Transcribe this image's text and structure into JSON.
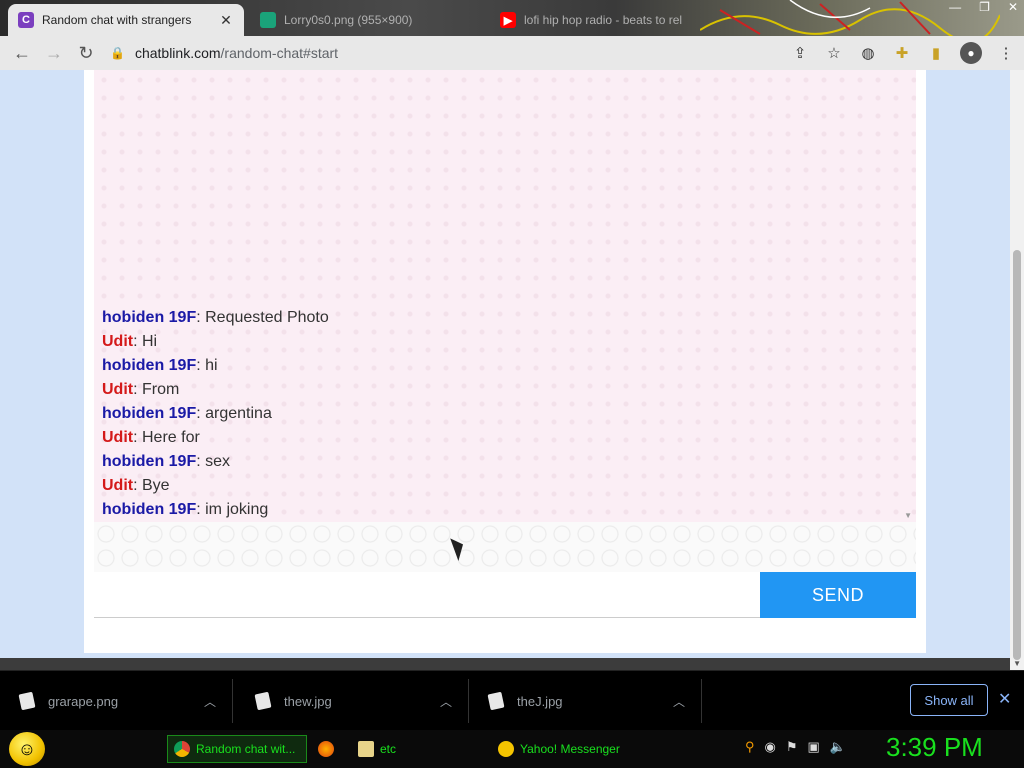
{
  "browser": {
    "tabs": [
      {
        "title": "Random chat with strangers",
        "favicon_letter": "C",
        "favicon_color": "#7b3fbf",
        "active": true
      },
      {
        "title": "Lorry0s0.png (955×900)",
        "favicon_color": "#1aa37a",
        "active": false
      },
      {
        "title": "lofi hip hop radio - beats to rel",
        "favicon_color": "#ff0000",
        "active": false
      }
    ],
    "url_domain": "chatblink.com",
    "url_path": "/random-chat#start"
  },
  "chat": {
    "messages": [
      {
        "sender": "hobiden 19F",
        "role": "stranger",
        "text": ": Requested Photo"
      },
      {
        "sender": "Udit",
        "role": "me",
        "text": ": Hi"
      },
      {
        "sender": "hobiden 19F",
        "role": "stranger",
        "text": ": hi"
      },
      {
        "sender": "Udit",
        "role": "me",
        "text": ": From"
      },
      {
        "sender": "hobiden 19F",
        "role": "stranger",
        "text": ": argentina"
      },
      {
        "sender": "Udit",
        "role": "me",
        "text": ": Here for"
      },
      {
        "sender": "hobiden 19F",
        "role": "stranger",
        "text": ": sex"
      },
      {
        "sender": "Udit",
        "role": "me",
        "text": ": Bye"
      },
      {
        "sender": "hobiden 19F",
        "role": "stranger",
        "text": ": im joking"
      }
    ],
    "input_value": "",
    "send_label": "SEND",
    "colors": {
      "stranger": "#1a1aa6",
      "me": "#d41a1a",
      "send": "#2196f3"
    }
  },
  "downloads": {
    "items": [
      {
        "name": "grarape.png"
      },
      {
        "name": "thew.jpg"
      },
      {
        "name": "theJ.jpg"
      }
    ],
    "show_all_label": "Show all"
  },
  "taskbar": {
    "tasks": [
      {
        "label": "Random chat wit...",
        "icon": "chrome-icon",
        "active": true
      },
      {
        "label": "",
        "icon": "firefox-icon",
        "active": false
      },
      {
        "label": "etc",
        "icon": "folder-icon",
        "active": false
      },
      {
        "label": "Yahoo! Messenger",
        "icon": "yahoo-messenger-icon",
        "active": false
      }
    ],
    "clock": "3:39 PM"
  }
}
